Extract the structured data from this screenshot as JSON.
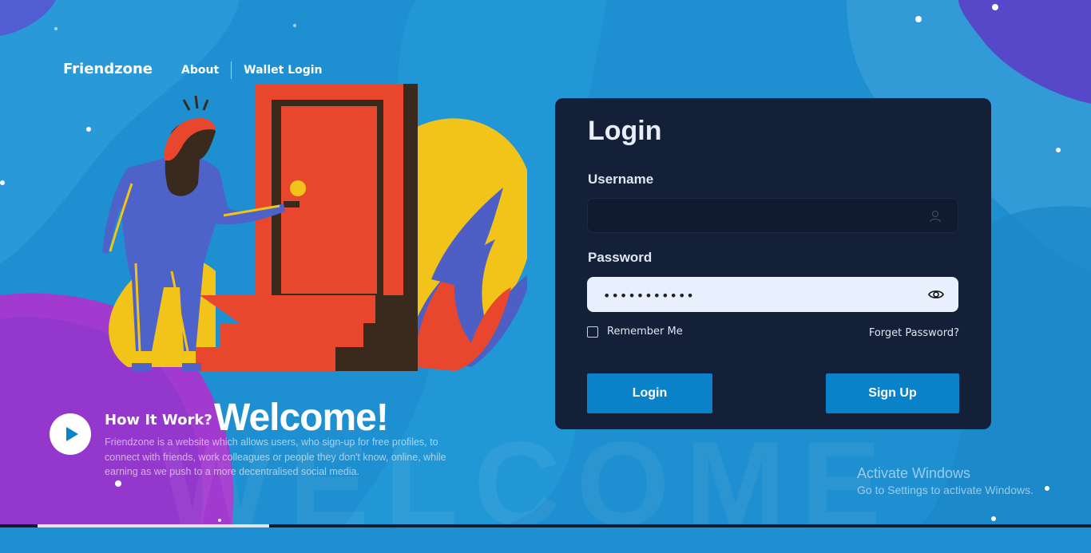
{
  "brand": "Friendzone",
  "nav": {
    "about": "About",
    "wallet_login": "Wallet Login"
  },
  "login": {
    "title": "Login",
    "username_label": "Username",
    "username_value": "",
    "password_label": "Password",
    "password_value": "•••••••••••",
    "remember_label": "Remember Me",
    "forget_label": "Forget Password?",
    "login_button": "Login",
    "signup_button": "Sign Up"
  },
  "hero": {
    "how_title": "How It Work?",
    "welcome": "Welcome!",
    "description": "Friendzone is a website which allows users, who sign-up for free profiles, to connect with friends, work colleagues or people they don't know, online, while earning as we push to a more decentralised social media."
  },
  "watermark": "WELCOME",
  "os_overlay": {
    "title": "Activate Windows",
    "subtitle": "Go to Settings to activate Windows."
  },
  "colors": {
    "background": "#1e8fd0",
    "card": "#132038",
    "button": "#0a82c9",
    "door": "#e8472e",
    "yellow": "#f2c419",
    "purple": "#a23ad0"
  },
  "icons": {
    "user_field": "user-icon",
    "password_field": "eye-icon",
    "play": "play-icon"
  }
}
